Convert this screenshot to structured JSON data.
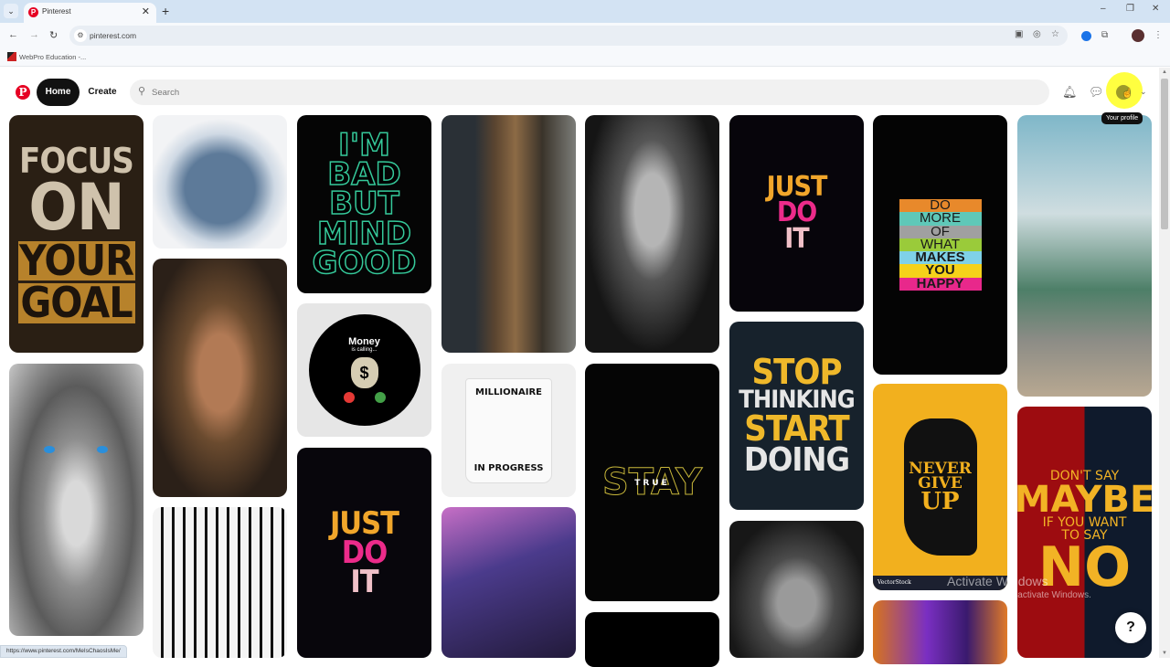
{
  "browser": {
    "tab": {
      "title": "Pinterest",
      "favicon": "pinterest-logo-icon"
    },
    "url": "pinterest.com",
    "bookmarks": [
      {
        "label": "WebPro Education -..."
      }
    ],
    "status_url": "https://www.pinterest.com/MeIsChaosIsMe/",
    "window_controls": {
      "minimize": "–",
      "restore": "❐",
      "close": "✕"
    }
  },
  "header": {
    "logo": "P",
    "home_label": "Home",
    "create_label": "Create",
    "search_placeholder": "Search",
    "search_value": "",
    "tooltip": "Your profile"
  },
  "pins": {
    "focus": [
      "FOCUS",
      "ON",
      "YOUR",
      "GOAL"
    ],
    "bad": [
      "I'M",
      "BAD",
      "BUT",
      "MIND",
      "GOOD"
    ],
    "money": {
      "title": "Money",
      "subtitle": "is calling...",
      "symbol": "$"
    },
    "mug": [
      "MILLIONAIRE",
      "IN PROGRESS"
    ],
    "stay": {
      "big": "STAY",
      "small": "TRUE"
    },
    "just_do_it": [
      "JUST",
      "DO",
      "IT"
    ],
    "stop": [
      "STOP",
      "THINKING",
      "START",
      "DOING"
    ],
    "do_more": [
      "DO",
      "MORE",
      "OF",
      "WHAT",
      "MAKES",
      "YOU",
      "HAPPY"
    ],
    "do_more_colors": [
      "#e8892b",
      "#5fc8b8",
      "#a0a0a0",
      "#9acb3a",
      "#7fd1e8",
      "#f5d21a",
      "#e8288b"
    ],
    "never": [
      "NEVER",
      "GIVE",
      "UP"
    ],
    "never_watermark": "VectorStock",
    "maybe": [
      "DON'T SAY",
      "MAYBE",
      "IF YOU WANT",
      "TO SAY",
      "NO"
    ]
  },
  "overlay": {
    "activate_title": "Activate Windows",
    "activate_sub": "Go to Settings to activate Windows.",
    "help": "?"
  },
  "colors": {
    "brand": "#e60023",
    "home_bg": "#111111"
  }
}
